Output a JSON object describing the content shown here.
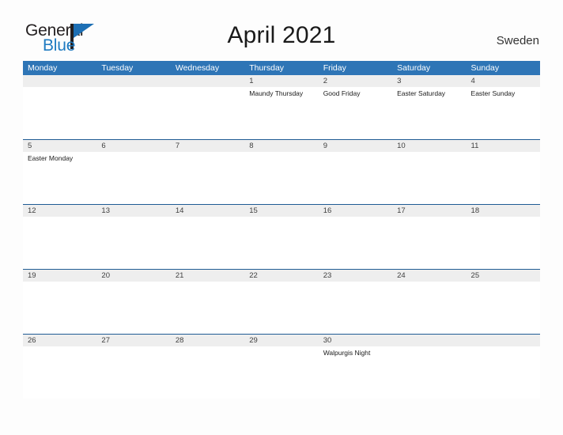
{
  "brand": {
    "name_part1": "General",
    "name_part2": "Blue",
    "flag_icon": "triangle-flag-icon",
    "colors": {
      "dark": "#231f20",
      "blue": "#1f7bc1"
    }
  },
  "header": {
    "title": "April 2021",
    "country": "Sweden"
  },
  "calendar": {
    "accent_color": "#2e75b6",
    "row_divider_color": "#1f5c94",
    "date_band_color": "#eeeeee",
    "weekdays": [
      "Monday",
      "Tuesday",
      "Wednesday",
      "Thursday",
      "Friday",
      "Saturday",
      "Sunday"
    ],
    "weeks": [
      [
        {
          "date": "",
          "events": []
        },
        {
          "date": "",
          "events": []
        },
        {
          "date": "",
          "events": []
        },
        {
          "date": "1",
          "events": [
            "Maundy Thursday"
          ]
        },
        {
          "date": "2",
          "events": [
            "Good Friday"
          ]
        },
        {
          "date": "3",
          "events": [
            "Easter Saturday"
          ]
        },
        {
          "date": "4",
          "events": [
            "Easter Sunday"
          ]
        }
      ],
      [
        {
          "date": "5",
          "events": [
            "Easter Monday"
          ]
        },
        {
          "date": "6",
          "events": []
        },
        {
          "date": "7",
          "events": []
        },
        {
          "date": "8",
          "events": []
        },
        {
          "date": "9",
          "events": []
        },
        {
          "date": "10",
          "events": []
        },
        {
          "date": "11",
          "events": []
        }
      ],
      [
        {
          "date": "12",
          "events": []
        },
        {
          "date": "13",
          "events": []
        },
        {
          "date": "14",
          "events": []
        },
        {
          "date": "15",
          "events": []
        },
        {
          "date": "16",
          "events": []
        },
        {
          "date": "17",
          "events": []
        },
        {
          "date": "18",
          "events": []
        }
      ],
      [
        {
          "date": "19",
          "events": []
        },
        {
          "date": "20",
          "events": []
        },
        {
          "date": "21",
          "events": []
        },
        {
          "date": "22",
          "events": []
        },
        {
          "date": "23",
          "events": []
        },
        {
          "date": "24",
          "events": []
        },
        {
          "date": "25",
          "events": []
        }
      ],
      [
        {
          "date": "26",
          "events": []
        },
        {
          "date": "27",
          "events": []
        },
        {
          "date": "28",
          "events": []
        },
        {
          "date": "29",
          "events": []
        },
        {
          "date": "30",
          "events": [
            "Walpurgis Night"
          ]
        },
        {
          "date": "",
          "events": []
        },
        {
          "date": "",
          "events": []
        }
      ]
    ]
  }
}
